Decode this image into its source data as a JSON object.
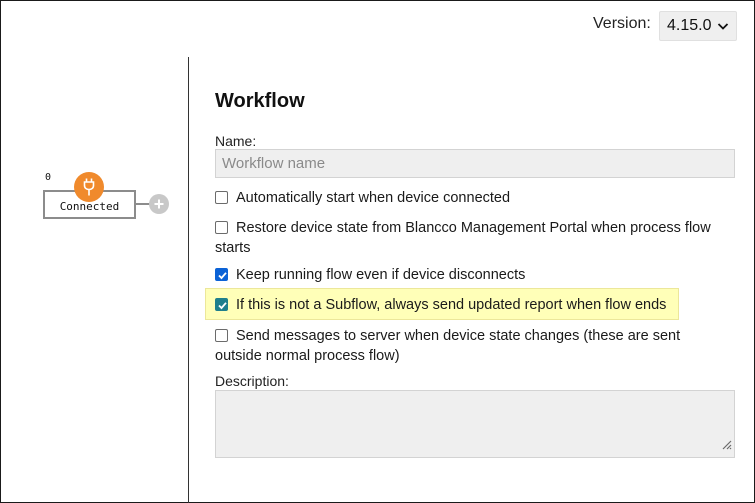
{
  "header": {
    "version_label": "Version:",
    "version_value": "4.15.0"
  },
  "canvas": {
    "node": {
      "index": "0",
      "label": "Connected",
      "icon": "plug-icon",
      "badge_color": "#f08a2c"
    },
    "add_icon": "plus-circle-icon"
  },
  "form": {
    "title": "Workflow",
    "name_label": "Name:",
    "name_value": "",
    "name_placeholder": "Workflow name",
    "options": [
      {
        "label": "Automatically start when device connected",
        "checked": false
      },
      {
        "label": "Restore device state from Blancco Management Portal when process flow starts",
        "checked": false
      },
      {
        "label": "Keep running flow even if device disconnects",
        "checked": true
      },
      {
        "label": "If this is not a Subflow, always send updated report when flow ends",
        "checked": true,
        "highlighted": true
      },
      {
        "label": "Send messages to server when device state changes (these are sent outside normal process flow)",
        "checked": false
      }
    ],
    "description_label": "Description:",
    "description_value": ""
  },
  "colors": {
    "checkbox_checked": "#0b62d6",
    "highlight": "#ffffb8",
    "node_badge": "#f08a2c"
  }
}
